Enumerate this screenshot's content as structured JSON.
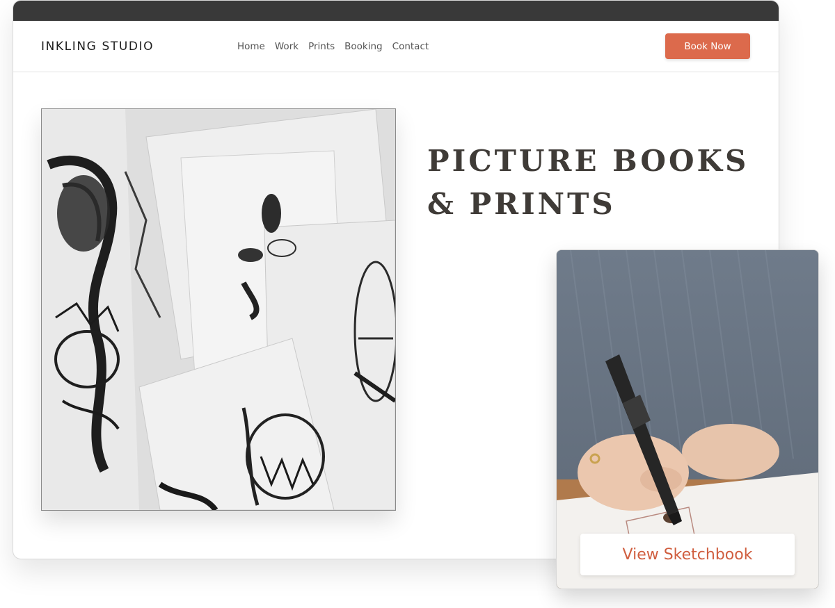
{
  "header": {
    "brand": "INKLING STUDIO",
    "nav": [
      "Home",
      "Work",
      "Prints",
      "Booking",
      "Contact"
    ],
    "cta_label": "Book Now"
  },
  "hero": {
    "title": "PICTURE BOOKS\n& PRINTS",
    "image_alt": "Black and white ink drawings scattered on paper"
  },
  "card": {
    "button_label": "View Sketchbook",
    "image_alt": "Hand drawing with a marker"
  },
  "colors": {
    "accent": "#dc6a4c",
    "topbar": "#393939",
    "title_text": "#3f3b37"
  }
}
